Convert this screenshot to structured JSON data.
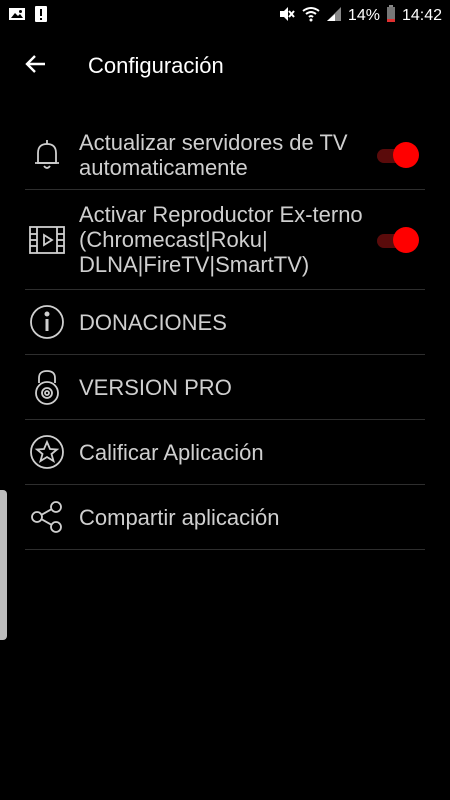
{
  "statusbar": {
    "battery_percent": "14%",
    "time": "14:42",
    "icons_left": [
      "image-icon",
      "alert-icon"
    ],
    "icons_right": [
      "mute-icon",
      "wifi-icon",
      "signal-icon",
      "battery-icon"
    ]
  },
  "appbar": {
    "title": "Configuración",
    "back_icon": "arrow-left-icon"
  },
  "settings": {
    "items": [
      {
        "label": "Actualizar servidores de TV automaticamente",
        "icon": "bell-icon",
        "toggle": true,
        "toggle_on": true
      },
      {
        "label": "Activar Reproductor Ex-terno (Chromecast|Roku| DLNA|FireTV|SmartTV)",
        "icon": "film-play-icon",
        "toggle": true,
        "toggle_on": true
      },
      {
        "label": "DONACIONES",
        "icon": "info-icon",
        "toggle": false
      },
      {
        "label": "VERSION PRO",
        "icon": "lock-gear-icon",
        "toggle": false
      },
      {
        "label": "Calificar Aplicación",
        "icon": "star-icon",
        "toggle": false
      },
      {
        "label": "Compartir aplicación",
        "icon": "share-icon",
        "toggle": false
      }
    ]
  },
  "colors": {
    "background": "#000000",
    "accent": "#ff0000",
    "text": "#cfcfcf",
    "divider": "#2e2e2e"
  }
}
